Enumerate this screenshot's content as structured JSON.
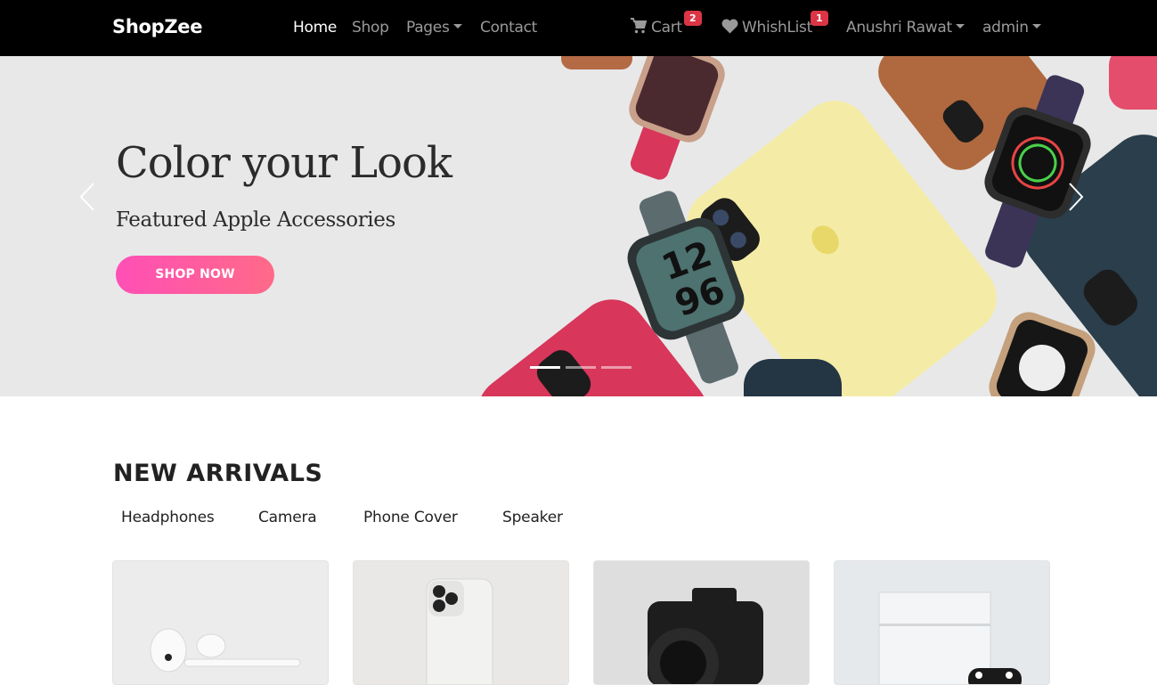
{
  "navbar": {
    "brand": "ShopZee",
    "links": {
      "home": "Home",
      "shop": "Shop",
      "pages": "Pages",
      "contact": "Contact"
    },
    "cart": {
      "label": "Cart",
      "count": "2",
      "icon": "cart-icon"
    },
    "wishlist": {
      "label": "WhishList",
      "count": "1",
      "icon": "heart-icon"
    },
    "user_menu": "Anushri Rawat",
    "admin_menu": "admin"
  },
  "hero": {
    "title": "Color your Look",
    "subtitle": "Featured Apple Accessories",
    "button": "SHOP NOW",
    "slide_count": 3,
    "active_slide": 1
  },
  "new_arrivals": {
    "title": "NEW ARRIVALS",
    "categories": [
      "Headphones",
      "Camera",
      "Phone Cover",
      "Speaker"
    ],
    "products": [
      {
        "image": "airpods"
      },
      {
        "image": "iphone"
      },
      {
        "image": "camera"
      },
      {
        "image": "game-console"
      }
    ]
  },
  "colors": {
    "navbar_bg": "#000000",
    "badge": "#dc3545",
    "button_gradient_start": "#ff4fb6",
    "button_gradient_end": "#ff6a88"
  }
}
